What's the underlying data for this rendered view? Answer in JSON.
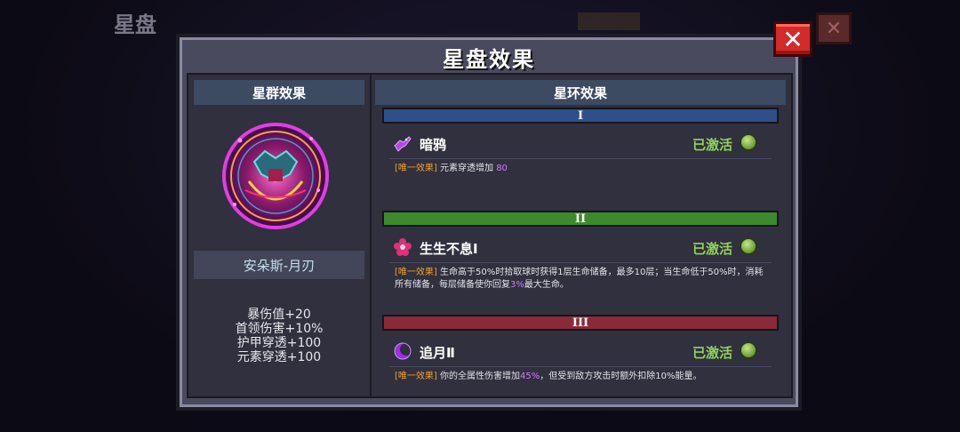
{
  "background": {
    "title": "星盘",
    "close_label": "✕"
  },
  "panel": {
    "title": "星盘效果",
    "close_label": "✕"
  },
  "left": {
    "header": "星群效果",
    "constellation_name": "安朵斯-月刃",
    "stats": [
      "暴伤值+20",
      "首领伤害+10%",
      "护甲穿透+100",
      "元素穿透+100"
    ]
  },
  "right": {
    "header": "星环效果",
    "tiers": [
      {
        "numeral": "I",
        "color": "#2f4f8a",
        "effect": {
          "icon": "crow-icon",
          "name": "暗鸦",
          "status": "已激活",
          "tag": "[唯一效果]",
          "desc_before": "元素穿透增加",
          "desc_highlight": "80",
          "desc_after": ""
        }
      },
      {
        "numeral": "II",
        "color": "#3d8a2c",
        "effect": {
          "icon": "flower-icon",
          "name": "生生不息Ⅰ",
          "status": "已激活",
          "tag": "[唯一效果]",
          "desc_before": "生命高于50%时拾取球时获得1层生命储备，最多10层；当生命低于50%时，消耗所有储备，每层储备使你回复",
          "desc_highlight": "3%",
          "desc_after": "最大生命。"
        }
      },
      {
        "numeral": "III",
        "color": "#8a2a36",
        "effect": {
          "icon": "crescent-moon-icon",
          "name": "追月Ⅱ",
          "status": "已激活",
          "tag": "[唯一效果]",
          "desc_before": "你的全属性伤害增加",
          "desc_highlight": "45%",
          "desc_after": "，但受到敌方攻击时额外扣除10%能量。"
        }
      }
    ]
  },
  "colors": {
    "accent_active": "#8fd35a",
    "tag": "#f0a030",
    "highlight": "#d07aff",
    "close": "#d42a2a"
  }
}
